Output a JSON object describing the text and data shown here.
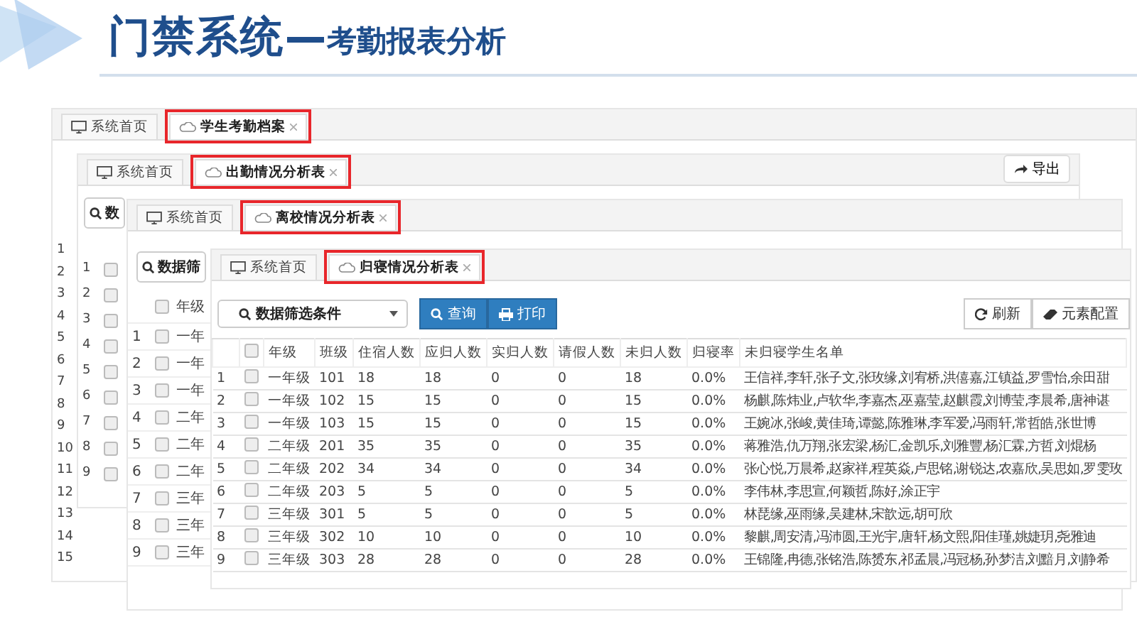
{
  "title": {
    "main": "门禁系统",
    "sub": "考勤报表分析"
  },
  "back_window": {
    "tabs": [
      {
        "label": "系统首页",
        "selected": false
      },
      {
        "label": "学生考勤档案",
        "selected": true
      }
    ],
    "row_numbers": [
      "1",
      "2",
      "3",
      "4",
      "5",
      "6",
      "7",
      "8",
      "9",
      "10",
      "11",
      "12",
      "13",
      "14",
      "15"
    ]
  },
  "second_window": {
    "tabs": [
      {
        "label": "系统首页",
        "selected": false
      },
      {
        "label": "出勤情况分析表",
        "selected": true
      }
    ],
    "search_button": "数",
    "export_button": "导出",
    "rows": [
      {
        "number": "1",
        "checked": false
      },
      {
        "number": "2",
        "checked": false
      },
      {
        "number": "3",
        "checked": false
      },
      {
        "number": "4",
        "checked": false
      },
      {
        "number": "5",
        "checked": false
      },
      {
        "number": "6",
        "checked": false
      },
      {
        "number": "7",
        "checked": false
      },
      {
        "number": "8",
        "checked": false
      },
      {
        "number": "9",
        "checked": false
      }
    ]
  },
  "third_window": {
    "tabs": [
      {
        "label": "系统首页",
        "selected": false
      },
      {
        "label": "离校情况分析表",
        "selected": true
      }
    ],
    "filter": "数据筛",
    "header_checked": false,
    "column": "年级",
    "rows": [
      {
        "number": "1",
        "checked": false,
        "grade": "一年"
      },
      {
        "number": "2",
        "checked": false,
        "grade": "一年"
      },
      {
        "number": "3",
        "checked": false,
        "grade": "一年"
      },
      {
        "number": "4",
        "checked": false,
        "grade": "二年"
      },
      {
        "number": "5",
        "checked": false,
        "grade": "二年"
      },
      {
        "number": "6",
        "checked": false,
        "grade": "二年"
      },
      {
        "number": "7",
        "checked": false,
        "grade": "三年"
      },
      {
        "number": "8",
        "checked": false,
        "grade": "三年"
      },
      {
        "number": "9",
        "checked": false,
        "grade": "三年"
      }
    ]
  },
  "front_window": {
    "tabs": [
      {
        "label": "系统首页",
        "selected": false
      },
      {
        "label": "归寝情况分析表",
        "selected": true
      }
    ],
    "filter": "数据筛选条件",
    "query_button": "查询",
    "print_button": "打印",
    "refresh_button": "刷新",
    "config_button": "元素配置",
    "header_checked": false,
    "columns": [
      "年级",
      "班级",
      "住宿人数",
      "应归人数",
      "实归人数",
      "请假人数",
      "未归人数",
      "归寝率",
      "未归寝学生名单"
    ],
    "rows": [
      {
        "number": "1",
        "checked": false,
        "cells": [
          "一年级",
          "101",
          "18",
          "18",
          "0",
          "0",
          "18",
          "0.0%",
          "王信祥,李轩,张子文,张玫缘,刘宥桥,洪僖嘉,江镇益,罗雪怡,余田甜"
        ]
      },
      {
        "number": "2",
        "checked": false,
        "cells": [
          "一年级",
          "102",
          "15",
          "15",
          "0",
          "0",
          "15",
          "0.0%",
          "杨麒,陈炜业,卢软华,李嘉杰,巫嘉莹,赵麒霞,刘博莹,李晨希,唐神谌"
        ]
      },
      {
        "number": "3",
        "checked": false,
        "cells": [
          "一年级",
          "103",
          "15",
          "15",
          "0",
          "0",
          "15",
          "0.0%",
          "王婉冰,张峻,黄佳琦,谭懿,陈雅琳,李军爱,冯雨轩,常哲皓,张世博"
        ]
      },
      {
        "number": "4",
        "checked": false,
        "cells": [
          "二年级",
          "201",
          "35",
          "35",
          "0",
          "0",
          "35",
          "0.0%",
          "蒋雅浩,仇万翔,张宏梁,杨汇,金凯乐,刘雅豐,杨汇霖,方哲,刘焜杨"
        ]
      },
      {
        "number": "5",
        "checked": false,
        "cells": [
          "二年级",
          "202",
          "34",
          "34",
          "0",
          "0",
          "34",
          "0.0%",
          "张心悦,万晨希,赵家祥,程英焱,卢思铭,谢锐达,农嘉欣,吴思如,罗雯玫"
        ]
      },
      {
        "number": "6",
        "checked": false,
        "cells": [
          "二年级",
          "203",
          "5",
          "5",
          "0",
          "0",
          "5",
          "0.0%",
          "李伟林,李思宣,何颖哲,陈好,涂正宇"
        ]
      },
      {
        "number": "7",
        "checked": false,
        "cells": [
          "三年级",
          "301",
          "5",
          "5",
          "0",
          "0",
          "5",
          "0.0%",
          "林琵缘,巫雨缘,吴建林,宋歆远,胡可欣"
        ]
      },
      {
        "number": "8",
        "checked": false,
        "cells": [
          "三年级",
          "302",
          "10",
          "10",
          "0",
          "0",
          "10",
          "0.0%",
          "黎麒,周安清,冯沛圆,王光宇,唐轩,杨文熙,阳佳瑾,姚婕玥,尧雅迪"
        ]
      },
      {
        "number": "9",
        "checked": false,
        "cells": [
          "三年级",
          "303",
          "28",
          "28",
          "0",
          "0",
          "28",
          "0.0%",
          "王锦隆,冉德,张铭浩,陈赟东,祁孟晨,冯冠杨,孙梦洁,刘黯月,刘静希"
        ]
      }
    ]
  }
}
